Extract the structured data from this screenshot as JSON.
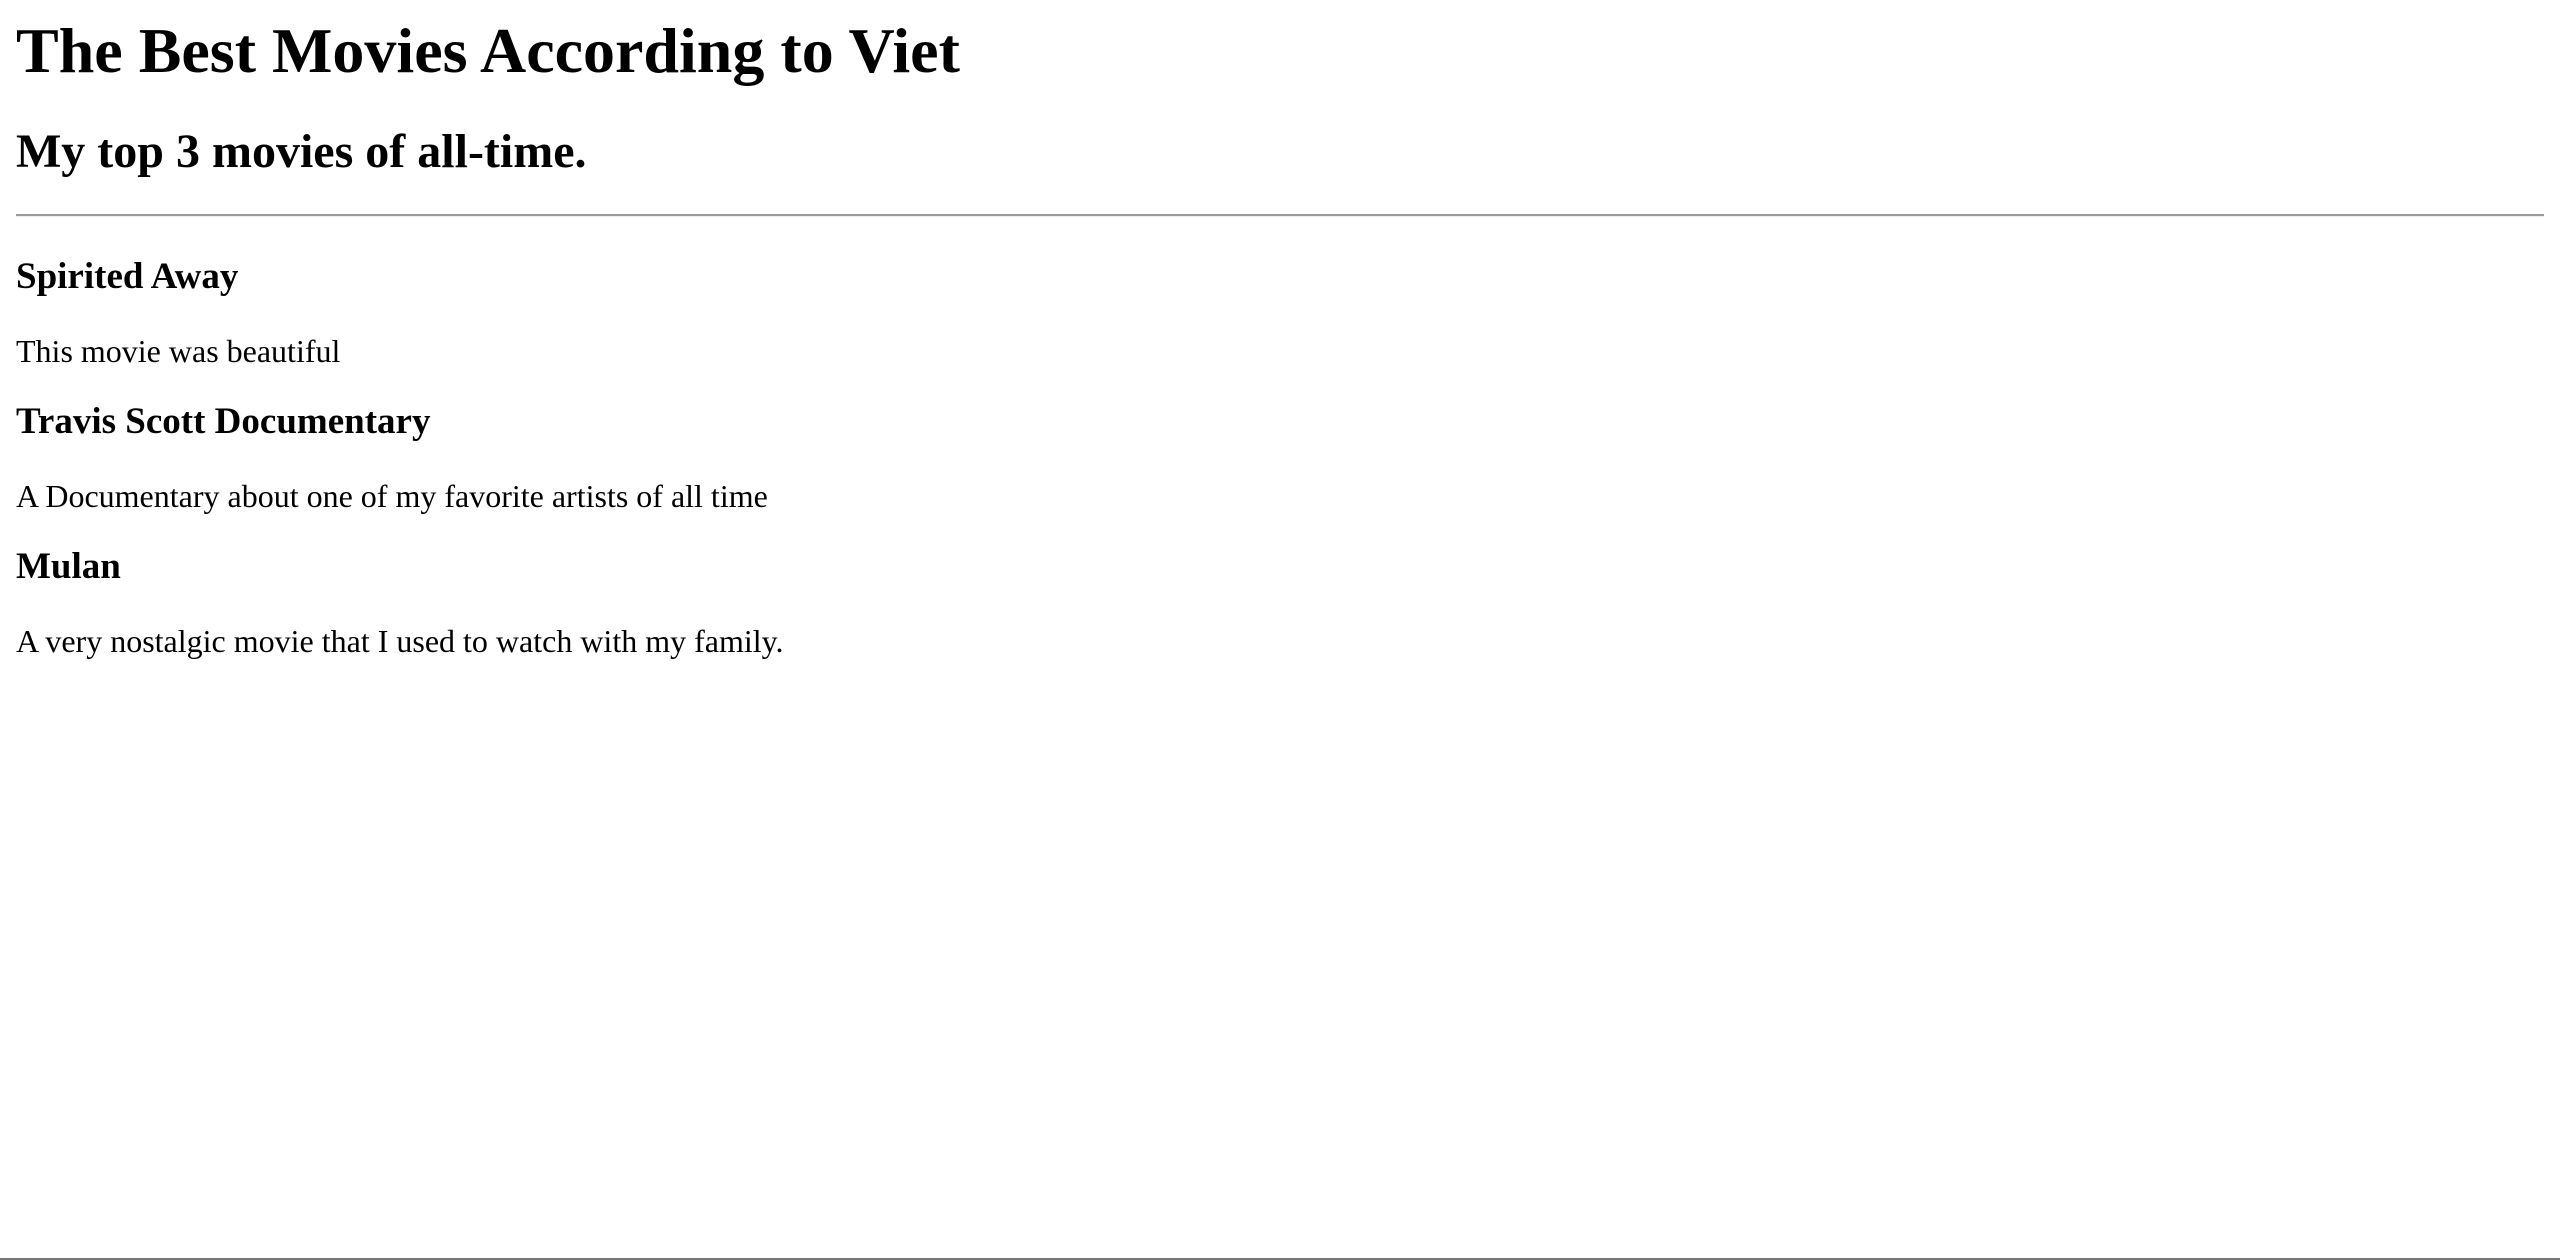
{
  "header": {
    "title": "The Best Movies According to Viet",
    "subtitle": "My top 3 movies of all-time."
  },
  "movies": [
    {
      "title": "Spirited Away",
      "description": "This movie was beautiful"
    },
    {
      "title": "Travis Scott Documentary",
      "description": "A Documentary about one of my favorite artists of all time"
    },
    {
      "title": "Mulan",
      "description": "A very nostalgic movie that I used to watch with my family."
    }
  ]
}
